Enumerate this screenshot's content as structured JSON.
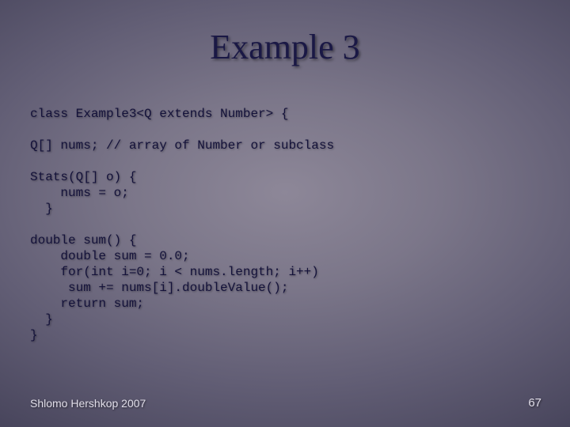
{
  "title": "Example 3",
  "code": "class Example3<Q extends Number> {\n\nQ[] nums; // array of Number or subclass\n\nStats(Q[] o) {\n    nums = o;\n  }\n\ndouble sum() {\n    double sum = 0.0;\n    for(int i=0; i < nums.length; i++)\n     sum += nums[i].doubleValue();\n    return sum;\n  }\n}",
  "footer_author": "Shlomo Hershkop 2007",
  "slide_number": "67"
}
